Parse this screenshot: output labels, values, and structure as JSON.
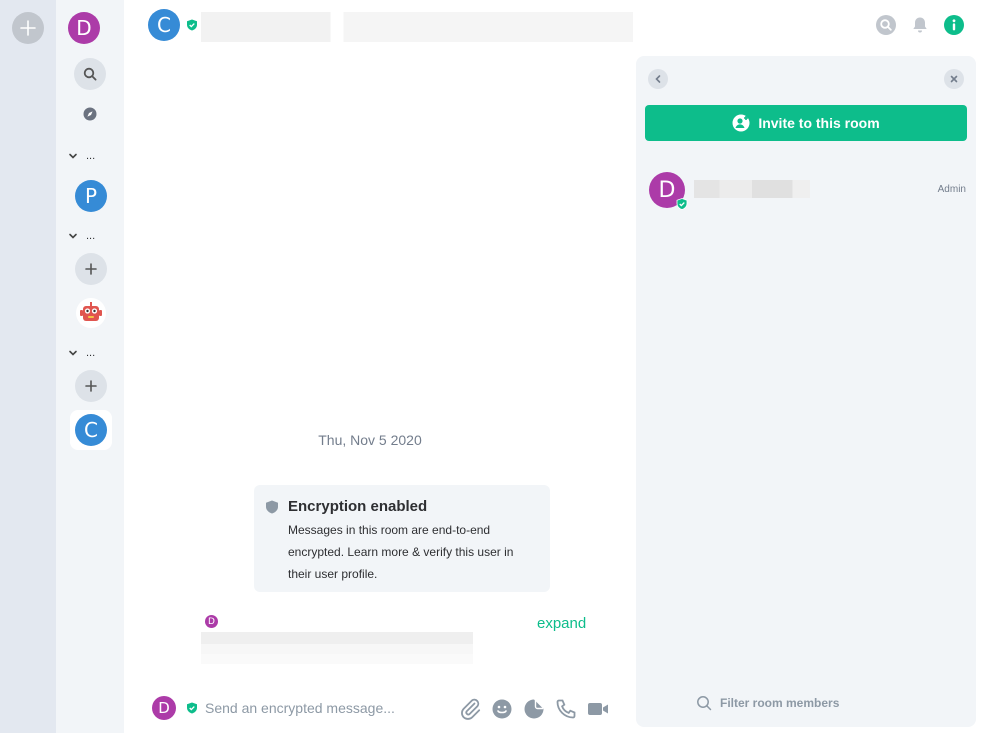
{
  "spaces": {
    "create_label": "+"
  },
  "user": {
    "initial": "D",
    "color": "#ac3ba8"
  },
  "room_list": {
    "sections": [
      {
        "label": "..."
      },
      {
        "label": "..."
      },
      {
        "label": "..."
      }
    ],
    "rooms": [
      {
        "initial": "P",
        "color": "#368bd6"
      },
      {
        "initial": "C",
        "color": "#368bd6"
      }
    ]
  },
  "header": {
    "room_initial": "C",
    "room_name": "",
    "icons": [
      "search-icon",
      "bell-icon",
      "info-icon"
    ]
  },
  "timeline": {
    "date": "Thu, Nov 5 2020",
    "encryption": {
      "title": "Encryption enabled",
      "body": "Messages in this room are end-to-end encrypted. Learn more & verify this user in their user profile."
    },
    "message": {
      "sender_initial": "D",
      "expand_label": "expand"
    }
  },
  "composer": {
    "initial": "D",
    "placeholder": "Send an encrypted message...",
    "icons": [
      "paperclip-icon",
      "emoji-icon",
      "sticker-icon",
      "phone-icon",
      "video-icon"
    ]
  },
  "panel": {
    "invite_label": "Invite to this room",
    "members": [
      {
        "initial": "D",
        "name": "",
        "role": "Admin"
      }
    ],
    "filter_placeholder": "Filter room members"
  },
  "colors": {
    "accent": "#0dbd8b",
    "avatar_purple": "#ac3ba8",
    "avatar_blue": "#368bd6"
  }
}
